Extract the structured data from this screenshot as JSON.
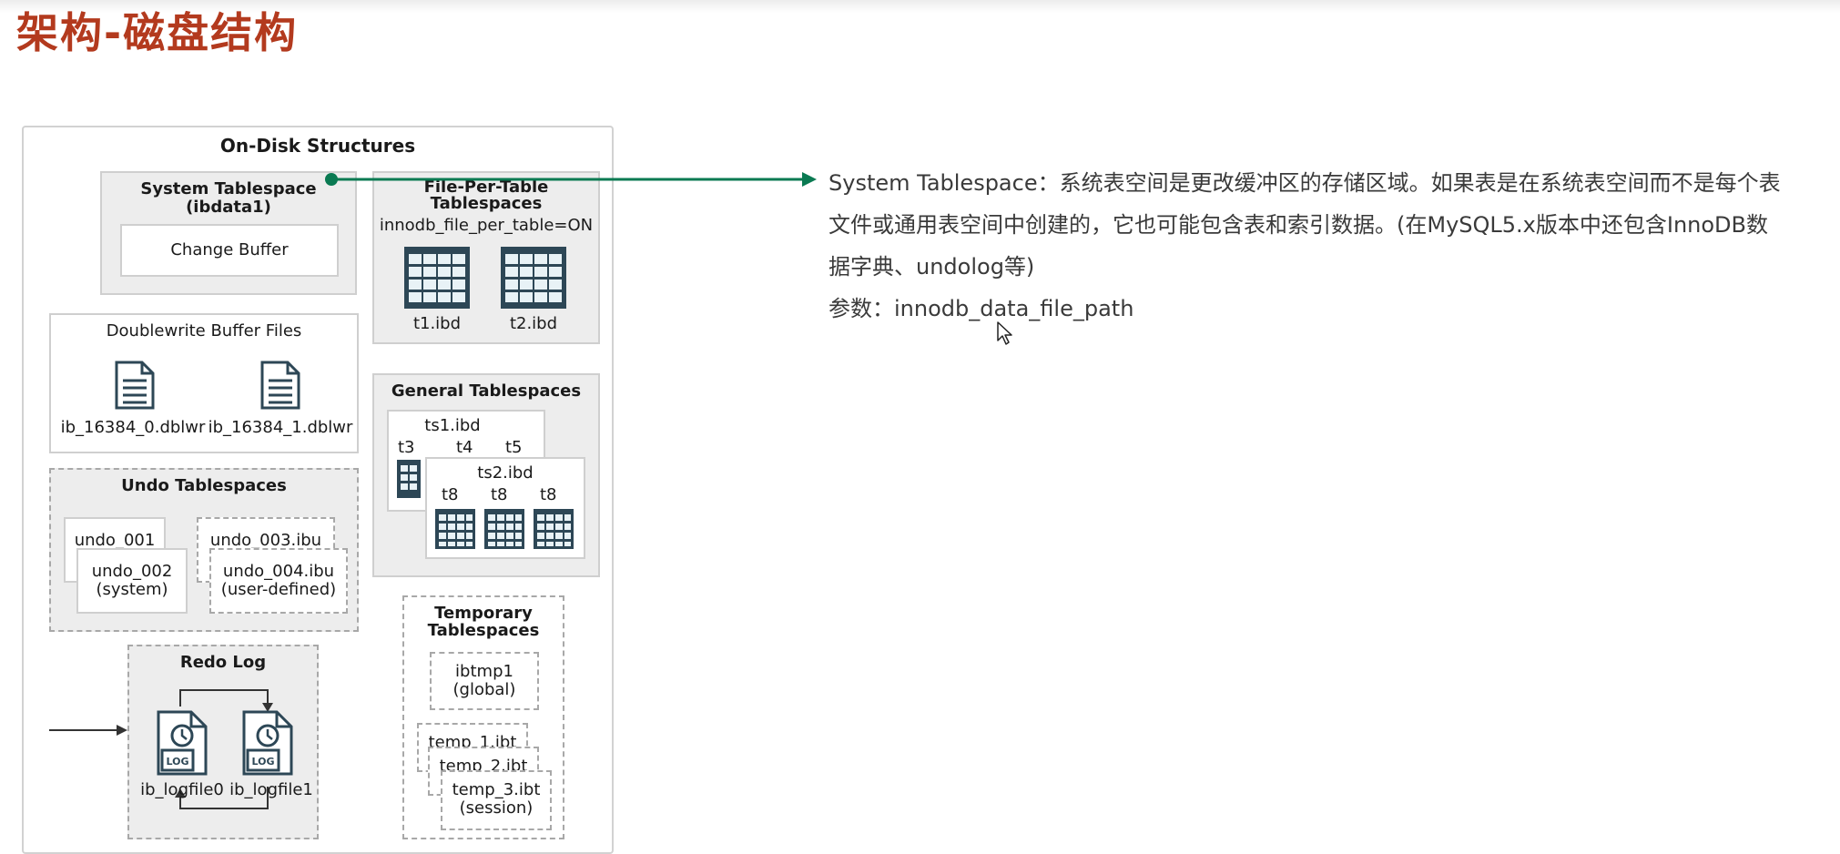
{
  "page": {
    "title": "架构-磁盘结构"
  },
  "diagram": {
    "title": "On-Disk Structures",
    "system_tablespace": {
      "name": "System Tablespace",
      "file": "(ibdata1)",
      "change_buffer": "Change Buffer"
    },
    "file_per_table": {
      "name_line1": "File-Per-Table",
      "name_line2": "Tablespaces",
      "setting": "innodb_file_per_table=ON",
      "files": [
        "t1.ibd",
        "t2.ibd"
      ]
    },
    "doublewrite": {
      "name": "Doublewrite Buffer Files",
      "files": [
        "ib_16384_0.dblwr",
        "ib_16384_1.dblwr"
      ]
    },
    "general": {
      "name": "General Tablespaces",
      "ts1": "ts1.ibd",
      "ts1_tables": [
        "t3",
        "t4",
        "t5"
      ],
      "ts2": "ts2.ibd",
      "ts2_tables": [
        "t8",
        "t8",
        "t8"
      ]
    },
    "undo": {
      "name": "Undo Tablespaces",
      "undo_001": "undo_001",
      "undo_002": "undo_002",
      "undo_002_sub": "(system)",
      "undo_003": "undo_003.ibu",
      "undo_004": "undo_004.ibu",
      "undo_004_sub": "(user-defined)"
    },
    "redo": {
      "name": "Redo Log",
      "files": [
        "ib_logfile0",
        "ib_logfile1"
      ],
      "icon_text": "LOG"
    },
    "temporary": {
      "name_line1": "Temporary",
      "name_line2": "Tablespaces",
      "ibtmp": "ibtmp1",
      "ibtmp_sub": "(global)",
      "temp1": "temp_1.ibt",
      "temp2": "temp_2.ibt",
      "temp3": "temp_3.ibt",
      "temp3_sub": "(session)"
    }
  },
  "description": {
    "line1": "System Tablespace：系统表空间是更改缓冲区的存储区域。如果表是在系统表空间而不是每个表",
    "line2": "文件或通用表空间中创建的，它也可能包含表和索引数据。(在MySQL5.x版本中还包含InnoDB数",
    "line3": "据字典、undolog等)",
    "param": "参数：innodb_data_file_path"
  },
  "colors": {
    "title": "#b33a1e",
    "arrow": "#0a7a52",
    "table_icon": "#2d4756"
  }
}
